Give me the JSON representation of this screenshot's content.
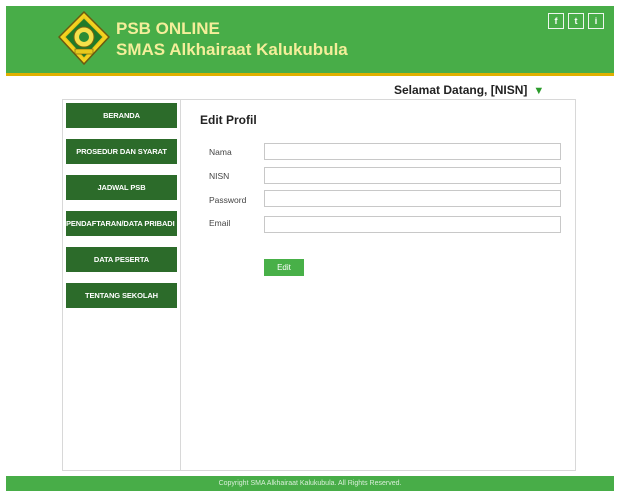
{
  "header": {
    "title_line1": "PSB ONLINE",
    "title_line2": "SMAS Alkhairaat Kalukubula",
    "social": [
      {
        "icon": "facebook-icon",
        "glyph": "f"
      },
      {
        "icon": "twitter-icon",
        "glyph": "t"
      },
      {
        "icon": "info-icon",
        "glyph": "i"
      }
    ]
  },
  "welcome": {
    "text": "Selamat Datang, [NISN]",
    "arrow": "▼"
  },
  "sidebar": {
    "items": [
      {
        "label": "BERANDA"
      },
      {
        "label": "PROSEDUR DAN SYARAT"
      },
      {
        "label": "JADWAL PSB"
      },
      {
        "label": "PENDAFTARAN/DATA PRIBADI"
      },
      {
        "label": "DATA PESERTA"
      },
      {
        "label": "TENTANG SEKOLAH"
      }
    ]
  },
  "form": {
    "title": "Edit Profil",
    "fields": [
      {
        "label": "Nama",
        "value": ""
      },
      {
        "label": "NISN",
        "value": ""
      },
      {
        "label": "Password",
        "value": ""
      },
      {
        "label": "Email",
        "value": ""
      }
    ],
    "submit_label": "Edit"
  },
  "footer": {
    "text": "Copyright SMA Alkhairaat Kalukubula. All Rights Reserved."
  },
  "colors": {
    "header_green": "#48ad48",
    "accent_gold": "#e0b000",
    "nav_dark_green": "#2c6b2a",
    "title_yellow": "#f4ee9a"
  }
}
